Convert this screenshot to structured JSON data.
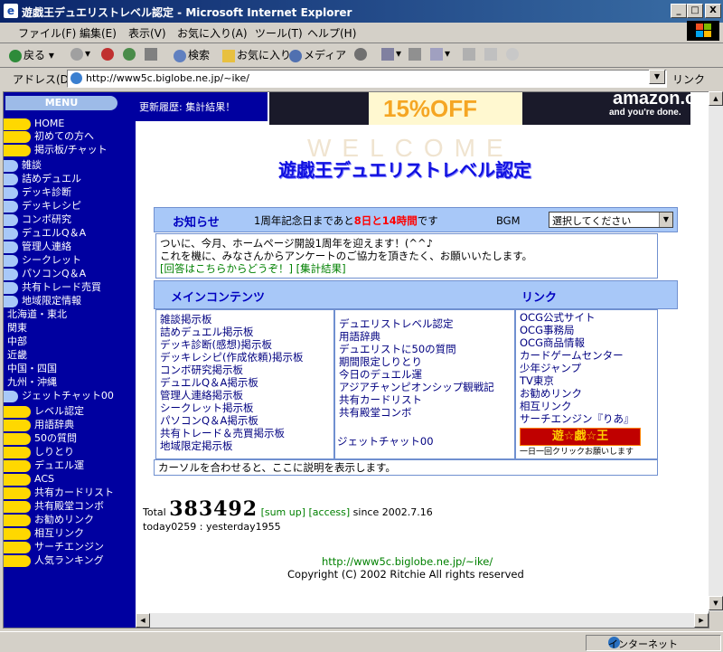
{
  "window": {
    "title": "遊戯王デュエリストレベル認定 - Microsoft Internet Explorer",
    "minimize": "_",
    "maximize": "□",
    "close": "X"
  },
  "menubar": [
    "ファイル(F)",
    "編集(E)",
    "表示(V)",
    "お気に入り(A)",
    "ツール(T)",
    "ヘルプ(H)"
  ],
  "toolbar": {
    "back": "戻る",
    "search": "検索",
    "favorites": "お気に入り",
    "media": "メディア"
  },
  "address": {
    "label": "アドレス(D)",
    "url": "http://www5c.biglobe.ne.jp/~ike/",
    "links": "リンク"
  },
  "status": {
    "zone": "インターネット"
  },
  "colors": {
    "frame_bg": "#0000a0",
    "pill_yellow": "#ffd800",
    "pill_blue": "#a8c8f8",
    "link_green": "#008000",
    "header_blue": "#a8c8f8"
  },
  "left_menu": {
    "header": "MENU",
    "items": [
      {
        "label": "HOME",
        "style": "yellow"
      },
      {
        "label": "初めての方へ",
        "style": "yellow"
      },
      {
        "label": "掲示板/チャット",
        "style": "yellow"
      },
      {
        "label": "雑談",
        "style": "blue"
      },
      {
        "label": "詰めデュエル",
        "style": "blue"
      },
      {
        "label": "デッキ診断",
        "style": "blue"
      },
      {
        "label": "デッキレシピ",
        "style": "blue"
      },
      {
        "label": "コンボ研究",
        "style": "blue"
      },
      {
        "label": "デュエルQ＆A",
        "style": "blue"
      },
      {
        "label": "管理人連絡",
        "style": "blue"
      },
      {
        "label": "シークレット",
        "style": "blue"
      },
      {
        "label": "パソコンQ＆A",
        "style": "blue"
      },
      {
        "label": "共有トレード売買",
        "style": "blue"
      },
      {
        "label": "地域限定情報",
        "style": "blue"
      },
      {
        "label": "北海道・東北",
        "style": "none"
      },
      {
        "label": "関東",
        "style": "none"
      },
      {
        "label": "中部",
        "style": "none"
      },
      {
        "label": "近畿",
        "style": "none"
      },
      {
        "label": "中国・四国",
        "style": "none"
      },
      {
        "label": "九州・沖縄",
        "style": "none"
      },
      {
        "label": "ジェットチャット00",
        "style": "blue"
      },
      {
        "label": "レベル認定",
        "style": "yellow"
      },
      {
        "label": "用語辞典",
        "style": "yellow"
      },
      {
        "label": "50の質問",
        "style": "yellow"
      },
      {
        "label": "しりとり",
        "style": "yellow"
      },
      {
        "label": "デュエル運",
        "style": "yellow"
      },
      {
        "label": "ACS",
        "style": "yellow"
      },
      {
        "label": "共有カードリスト",
        "style": "yellow"
      },
      {
        "label": "共有殿堂コンボ",
        "style": "yellow"
      },
      {
        "label": "お勧めリンク",
        "style": "yellow"
      },
      {
        "label": "相互リンク",
        "style": "yellow"
      },
      {
        "label": "サーチエンジン",
        "style": "yellow"
      },
      {
        "label": "人気ランキング",
        "style": "yellow"
      }
    ]
  },
  "update": "更新履歴: 集計結果！",
  "banner": {
    "discount": "15%OFF",
    "brand": "amazon.co.jp",
    "tagline": "and you're done."
  },
  "watermark": "WELCOME",
  "site_title": "遊戯王デュエリストレベル認定",
  "news": {
    "header": "お知らせ",
    "countdown_prefix": "1周年記念日まであと",
    "countdown_highlight": "8日と14時間",
    "countdown_suffix": "です",
    "bgm_label": "BGM",
    "bgm_select": "選択してください",
    "body_line1": "ついに、今月、ホームページ開設1周年を迎えます！(^^♪",
    "body_line2": "これを機に、みなさんからアンケートのご協力を頂きたく、お願いいたします。",
    "link1": "[回答はこちらからどうぞ！]",
    "link2": "[集計結果]"
  },
  "main_contents": {
    "header": "メインコンテンツ",
    "col1": [
      "雑談掲示板",
      "詰めデュエル掲示板",
      "デッキ診断(感想)掲示板",
      "デッキレシピ(作成依頼)掲示板",
      "コンボ研究掲示板",
      "デュエルQ＆A掲示板",
      "管理人連絡掲示板",
      "シークレット掲示板",
      "パソコンQ＆A掲示板",
      "共有トレード＆売買掲示板",
      "地域限定掲示板"
    ],
    "col2": [
      "デュエリストレベル認定",
      "用語辞典",
      "デュエリストに50の質問",
      "期間限定しりとり",
      "今日のデュエル運",
      "アジアチャンピオンシップ観戦記",
      "共有カードリスト",
      "共有殿堂コンボ"
    ],
    "col2_jet": "ジェットチャット00"
  },
  "links": {
    "header": "リンク",
    "items": [
      "OCG公式サイト",
      "OCG事務局",
      "OCG商品情報",
      "カードゲームセンター",
      "少年ジャンプ",
      "TV東京",
      "お勧めリンク",
      "相互リンク",
      "サーチエンジン『りあ』"
    ],
    "logo": "遊☆戯☆王",
    "logo_caption": "一日一回クリックお願いします"
  },
  "hint": "カーソルを合わせると、ここに説明を表示します。",
  "counter": {
    "total_label": "Total",
    "total": "383492",
    "sum_up": "[sum up]",
    "access": "[access]",
    "since": "since 2002.7.16",
    "today": "today0259 : yesterday1955"
  },
  "footer": {
    "url": "http://www5c.biglobe.ne.jp/~ike/",
    "copyright": "Copyright (C) 2002 Ritchie All rights reserved"
  }
}
